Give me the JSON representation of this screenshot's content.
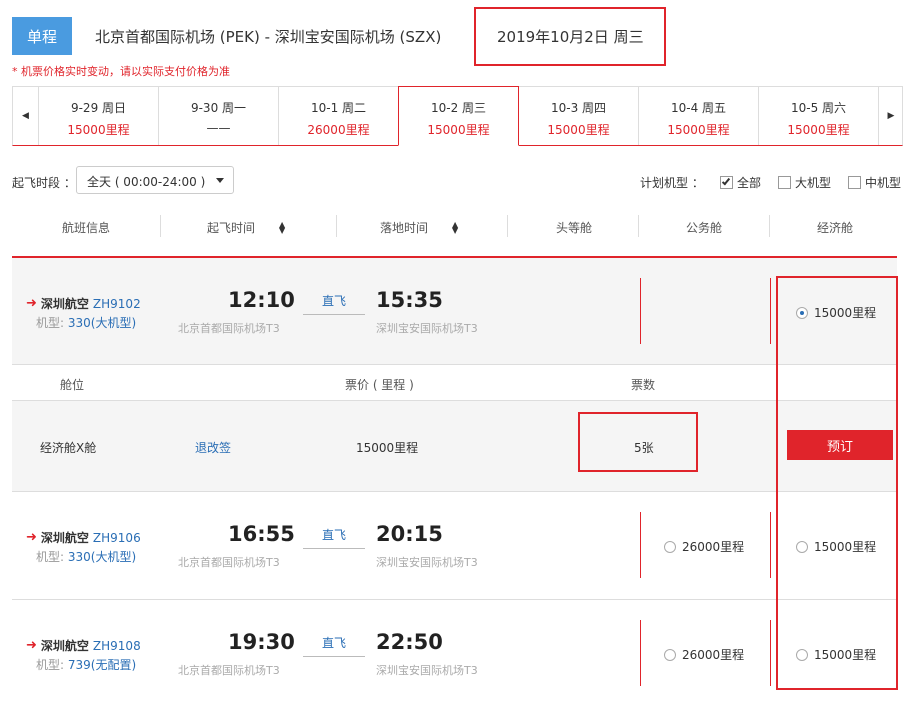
{
  "header": {
    "trip_type": "单程",
    "route": "北京首都国际机场 (PEK) - 深圳宝安国际机场 (SZX)",
    "date": "2019年10月2日 周三"
  },
  "notice": "* 机票价格实时变动，请以实际支付价格为准",
  "date_strip": [
    {
      "date": "9-29 周日",
      "price": "15000里程"
    },
    {
      "date": "9-30 周一",
      "price": "——"
    },
    {
      "date": "10-1 周二",
      "price": "26000里程"
    },
    {
      "date": "10-2 周三",
      "price": "15000里程"
    },
    {
      "date": "10-3 周四",
      "price": "15000里程"
    },
    {
      "date": "10-4 周五",
      "price": "15000里程"
    },
    {
      "date": "10-5 周六",
      "price": "15000里程"
    }
  ],
  "filters": {
    "time_label": "起飞时段 ：",
    "time_value": "全天 ( 00:00-24:00 )",
    "model_label": "计划机型 ：",
    "opt_all": "全部",
    "opt_large": "大机型",
    "opt_mid": "中机型"
  },
  "columns": {
    "info": "航班信息",
    "dep": "起飞时间",
    "arr": "落地时间",
    "first": "头等舱",
    "business": "公务舱",
    "economy": "经济舱"
  },
  "flights": [
    {
      "airline": "深圳航空",
      "no": "ZH9102",
      "model_prefix": "机型: ",
      "model": "330(大机型)",
      "dep_time": "12:10",
      "dep_airport": "北京首都国际机场T3",
      "direct": "直飞",
      "arr_time": "15:35",
      "arr_airport": "深圳宝安国际机场T3",
      "business": "",
      "economy": "15000里程"
    },
    {
      "airline": "深圳航空",
      "no": "ZH9106",
      "model_prefix": "机型: ",
      "model": "330(大机型)",
      "dep_time": "16:55",
      "dep_airport": "北京首都国际机场T3",
      "direct": "直飞",
      "arr_time": "20:15",
      "arr_airport": "深圳宝安国际机场T3",
      "business": "26000里程",
      "economy": "15000里程"
    },
    {
      "airline": "深圳航空",
      "no": "ZH9108",
      "model_prefix": "机型: ",
      "model": "739(无配置)",
      "dep_time": "19:30",
      "dep_airport": "北京首都国际机场T3",
      "direct": "直飞",
      "arr_time": "22:50",
      "arr_airport": "深圳宝安国际机场T3",
      "business": "26000里程",
      "economy": "15000里程"
    }
  ],
  "cabin_detail": {
    "h_cabin": "舱位",
    "h_price": "票价 ( 里程 )",
    "h_count": "票数",
    "cabin": "经济舱X舱",
    "refund": "退改签",
    "price": "15000里程",
    "count": "5张",
    "book": "预订"
  },
  "colors": {
    "accent_red": "#e0242b",
    "tab_blue": "#4a9be0",
    "link_blue": "#2a6eb5"
  }
}
